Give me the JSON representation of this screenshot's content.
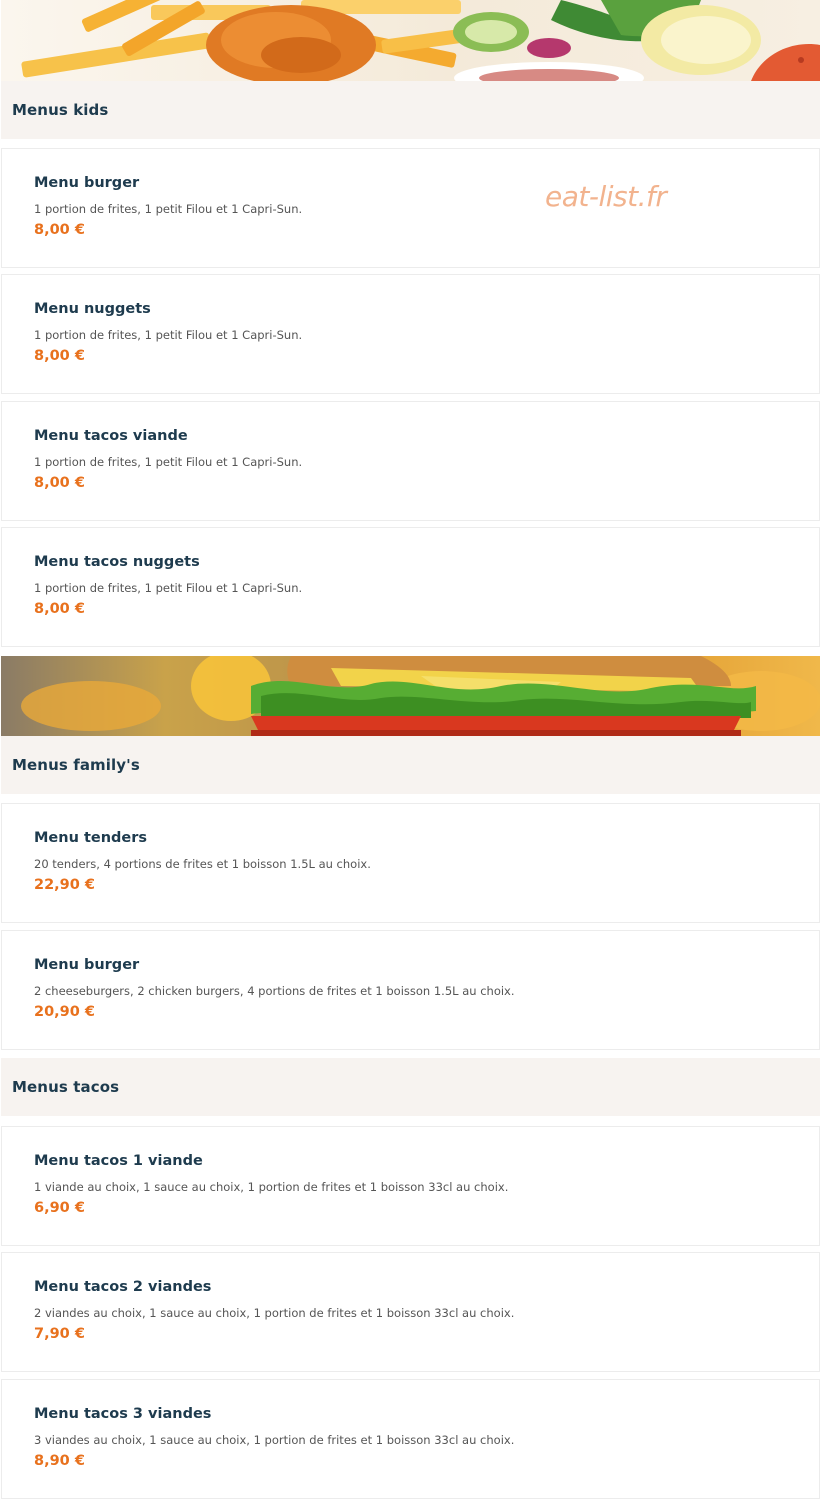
{
  "watermark": "eat-list.fr",
  "colors": {
    "accent_price": "#e8711d",
    "heading": "#1e3b4e",
    "section_bg": "#f7f3f0",
    "watermark": "#f2b38e"
  },
  "sections": [
    {
      "title": "Menus kids",
      "items": [
        {
          "name": "Menu burger",
          "desc": "1 portion de frites, 1 petit Filou et 1 Capri-Sun.",
          "price": "8,00 €"
        },
        {
          "name": "Menu nuggets",
          "desc": "1 portion de frites, 1 petit Filou et 1 Capri-Sun.",
          "price": "8,00 €"
        },
        {
          "name": "Menu tacos viande",
          "desc": "1 portion de frites, 1 petit Filou et 1 Capri-Sun.",
          "price": "8,00 €"
        },
        {
          "name": "Menu tacos nuggets",
          "desc": "1 portion de frites, 1 petit Filou et 1 Capri-Sun.",
          "price": "8,00 €"
        }
      ]
    },
    {
      "title": "Menus family's",
      "items": [
        {
          "name": "Menu tenders",
          "desc": "20 tenders, 4 portions de frites et 1 boisson 1.5L au choix.",
          "price": "22,90 €"
        },
        {
          "name": "Menu burger",
          "desc": "2 cheeseburgers, 2 chicken burgers, 4 portions de frites et 1 boisson 1.5L au choix.",
          "price": "20,90 €"
        }
      ]
    },
    {
      "title": "Menus tacos",
      "items": [
        {
          "name": "Menu tacos 1 viande",
          "desc": "1 viande au choix, 1 sauce au choix, 1 portion de frites et 1 boisson 33cl au choix.",
          "price": "6,90 €"
        },
        {
          "name": "Menu tacos 2 viandes",
          "desc": "2 viandes au choix, 1 sauce au choix, 1 portion de frites et 1 boisson 33cl au choix.",
          "price": "7,90 €"
        },
        {
          "name": "Menu tacos 3 viandes",
          "desc": "3 viandes au choix, 1 sauce au choix, 1 portion de frites et 1 boisson 33cl au choix.",
          "price": "8,90 €"
        }
      ]
    }
  ]
}
